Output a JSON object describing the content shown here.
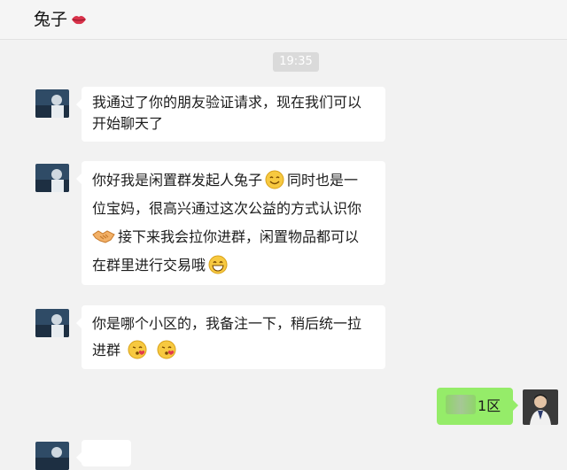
{
  "header": {
    "title": "兔子",
    "title_icon": "lips-icon"
  },
  "timestamp": "19:35",
  "messages": [
    {
      "from": "other",
      "avatar": "avatar-image",
      "line1": "我通过了你的朋友验证请求，现在我们可以",
      "line2": "开始聊天了"
    },
    {
      "from": "other",
      "avatar": "avatar-image",
      "l1a": "你好我是闲置群发起人兔子",
      "l1b": "同时也是一",
      "l2": "位宝妈，很高兴通过这次公益的方式认识你",
      "l3": "接下来我会拉你进群，闲置物品都可以",
      "l4": "在群里进行交易哦",
      "emojis": [
        "smile-emoji",
        "handshake-emoji",
        "grin-emoji"
      ]
    },
    {
      "from": "other",
      "avatar": "avatar-image",
      "line1": "你是哪个小区的，我备注一下，稍后统一拉",
      "line2": "进群",
      "emojis": [
        "kiss-emoji",
        "kiss-emoji"
      ]
    },
    {
      "from": "me",
      "avatar": "my-avatar-image",
      "text": "1区"
    }
  ],
  "colors": {
    "bg": "#f2f2f2",
    "other_bubble": "#ffffff",
    "my_bubble": "#95ec69",
    "time_chip": "#dadada"
  }
}
